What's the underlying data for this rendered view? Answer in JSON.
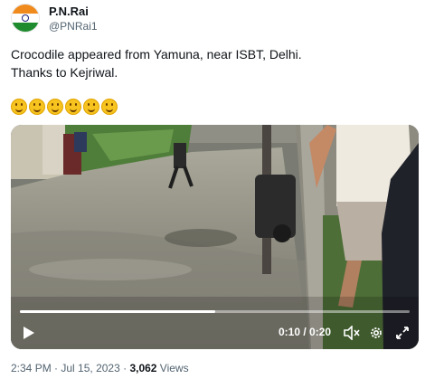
{
  "author": {
    "display_name": "P.N.Rai",
    "handle": "@PNRai1",
    "avatar_icon": "india-flag-avatar"
  },
  "tweet": {
    "line1": "Crocodile appeared from Yamuna, near ISBT, Delhi.",
    "line2": "Thanks to Kejriwal.",
    "emoji_count": 6
  },
  "video": {
    "current_time": "0:10",
    "separator": " / ",
    "duration": "0:20",
    "progress_fraction": 0.5
  },
  "meta": {
    "time": "2:34 PM",
    "dot1": " · ",
    "date": "Jul 15, 2023",
    "dot2": " · ",
    "views_count": "3,062",
    "views_label": " Views"
  },
  "colors": {
    "text_primary": "#0f1419",
    "text_secondary": "#536471"
  }
}
